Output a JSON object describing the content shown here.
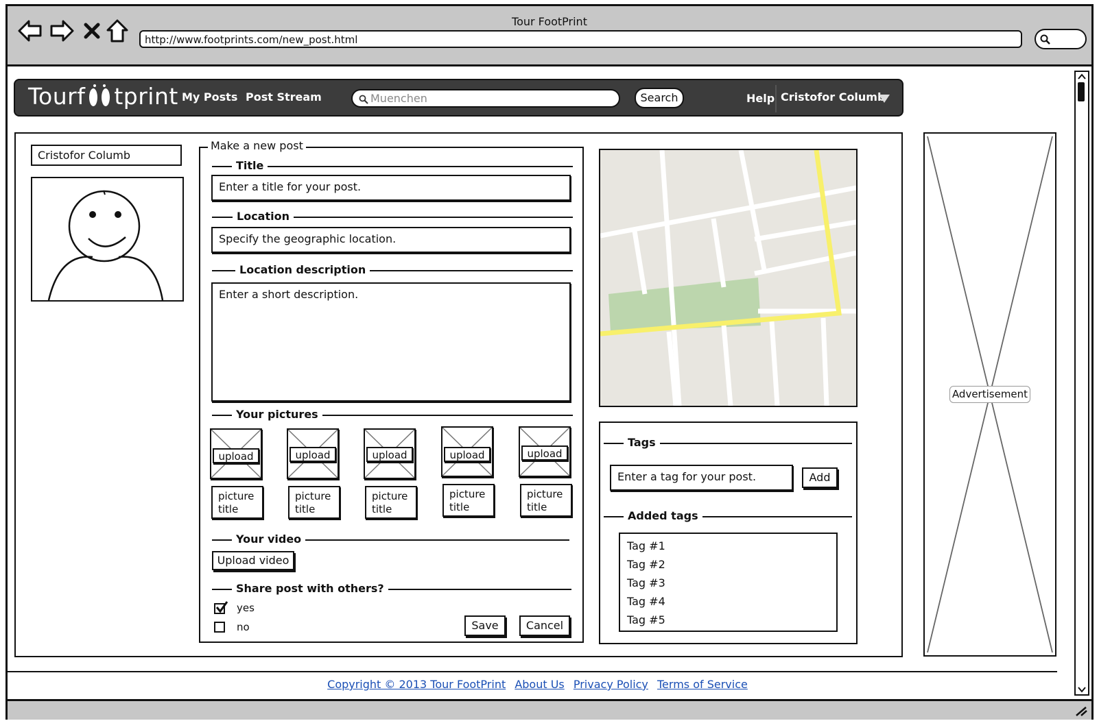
{
  "window": {
    "title": "Tour FootPrint",
    "url": "http://www.footprints.com/new_post.html"
  },
  "navbar": {
    "logo_left": "Tourf",
    "logo_right": "tprint",
    "links": [
      "My Posts",
      "Post Stream"
    ],
    "search_placeholder": "Muenchen",
    "search_button": "Search",
    "help": "Help",
    "user": "Cristofor Columb"
  },
  "sidebar": {
    "user_name": "Cristofor Columb"
  },
  "form": {
    "legend": "Make a new post",
    "title_label": "Title",
    "title_placeholder": "Enter a title for your post.",
    "location_label": "Location",
    "location_placeholder": "Specify the geographic location.",
    "description_label": "Location description",
    "description_placeholder": "Enter a short description.",
    "pictures_label": "Your pictures",
    "upload_label": "upload",
    "picture_captions": [
      "picture title",
      "picture title",
      "picture title",
      "picture title",
      "picture title"
    ],
    "video_label": "Your video",
    "video_button": "Upload video",
    "share_label": "Share post with others?",
    "share_yes": "yes",
    "share_no": "no",
    "share_yes_checked": true,
    "save_button": "Save",
    "cancel_button": "Cancel"
  },
  "tags": {
    "label": "Tags",
    "placeholder": "Enter a tag for your post.",
    "add_button": "Add",
    "added_label": "Added tags",
    "items": [
      "Tag #1",
      "Tag #2",
      "Tag #3",
      "Tag #4",
      "Tag #5"
    ]
  },
  "ad": {
    "label": "Advertisement"
  },
  "footer": {
    "links": [
      "Copyright © 2013 Tour FootPrint",
      "About Us",
      "Privacy Policy",
      "Terms of Service"
    ]
  }
}
